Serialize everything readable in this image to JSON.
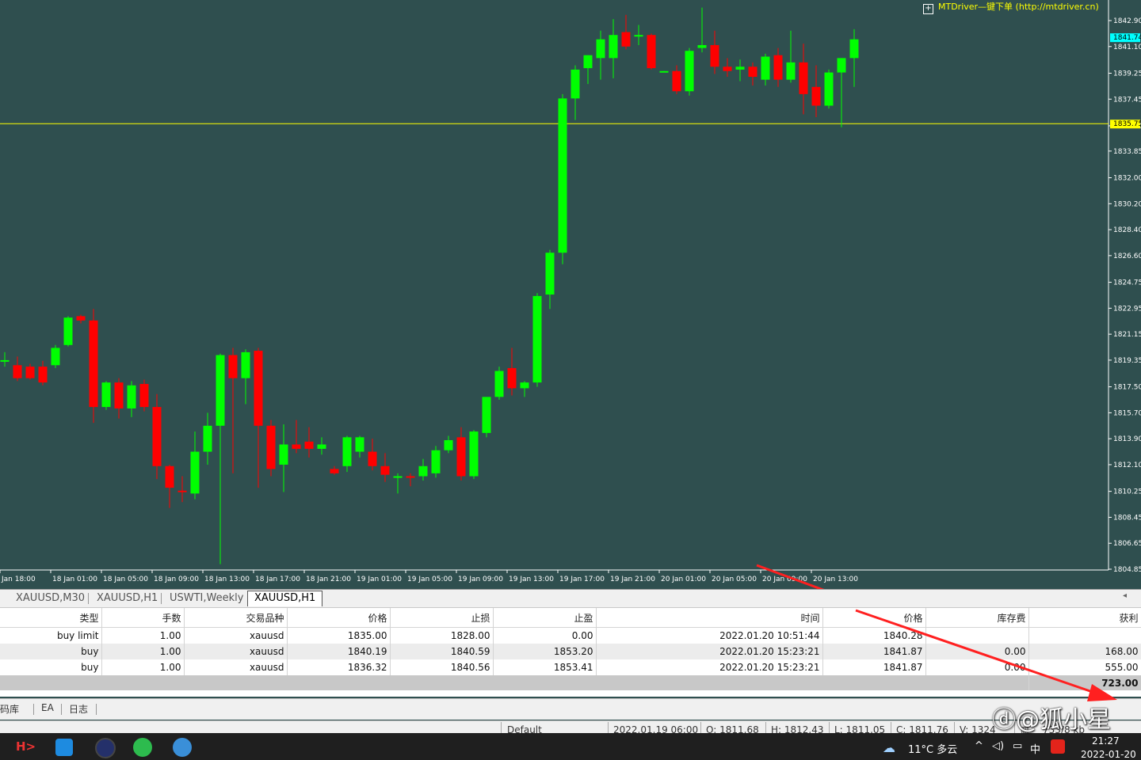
{
  "chart": {
    "plugin_label": "MTDriver—键下单 (http://mtdriver.cn)",
    "price_labels": [
      "1842.90",
      "1841.10",
      "1839.25",
      "1837.45",
      "1835.60",
      "1833.85",
      "1832.00",
      "1830.20",
      "1828.40",
      "1826.60",
      "1824.75",
      "1822.95",
      "1821.15",
      "1819.35",
      "1817.50",
      "1815.70",
      "1813.90",
      "1812.10",
      "1810.25",
      "1808.45",
      "1806.65",
      "1804.85"
    ],
    "current_price_label": "1841.74",
    "hline_price_label": "1835.75",
    "time_labels": [
      "Jan 18:00",
      "18 Jan 01:00",
      "18 Jan 05:00",
      "18 Jan 09:00",
      "18 Jan 13:00",
      "18 Jan 17:00",
      "18 Jan 21:00",
      "19 Jan 01:00",
      "19 Jan 05:00",
      "19 Jan 09:00",
      "19 Jan 13:00",
      "19 Jan 17:00",
      "19 Jan 21:00",
      "20 Jan 01:00",
      "20 Jan 05:00",
      "20 Jan 09:00",
      "20 Jan 13:00"
    ],
    "bull_color": "#00ff00",
    "bear_color": "#ff0000",
    "grid_color": "#ffff00"
  },
  "chart_data": {
    "type": "candlestick",
    "symbol": "XAUUSD",
    "timeframe": "H1",
    "ylim": [
      1804.85,
      1842.9
    ],
    "hline": 1835.75,
    "candles": [
      {
        "o": 1819.35,
        "h": 1819.9,
        "l": 1818.9,
        "c": 1819.35
      },
      {
        "o": 1819.0,
        "h": 1819.6,
        "l": 1817.9,
        "c": 1818.1
      },
      {
        "o": 1818.9,
        "h": 1819.1,
        "l": 1818.0,
        "c": 1818.1
      },
      {
        "o": 1818.9,
        "h": 1819.3,
        "l": 1817.6,
        "c": 1817.8
      },
      {
        "o": 1819.0,
        "h": 1820.4,
        "l": 1818.8,
        "c": 1820.2
      },
      {
        "o": 1820.4,
        "h": 1822.4,
        "l": 1820.3,
        "c": 1822.3
      },
      {
        "o": 1822.4,
        "h": 1822.5,
        "l": 1821.9,
        "c": 1822.1
      },
      {
        "o": 1822.1,
        "h": 1822.9,
        "l": 1815.0,
        "c": 1816.1
      },
      {
        "o": 1816.1,
        "h": 1817.9,
        "l": 1815.9,
        "c": 1817.8
      },
      {
        "o": 1817.8,
        "h": 1818.1,
        "l": 1815.3,
        "c": 1816.0
      },
      {
        "o": 1816.0,
        "h": 1817.9,
        "l": 1815.4,
        "c": 1817.6
      },
      {
        "o": 1817.7,
        "h": 1818.0,
        "l": 1815.8,
        "c": 1816.1
      },
      {
        "o": 1816.1,
        "h": 1817.0,
        "l": 1811.1,
        "c": 1812.0
      },
      {
        "o": 1812.0,
        "h": 1812.1,
        "l": 1809.1,
        "c": 1810.5
      },
      {
        "o": 1810.3,
        "h": 1811.3,
        "l": 1809.5,
        "c": 1810.2
      },
      {
        "o": 1810.1,
        "h": 1814.4,
        "l": 1809.7,
        "c": 1813.0
      },
      {
        "o": 1813.0,
        "h": 1815.7,
        "l": 1812.1,
        "c": 1814.8
      },
      {
        "o": 1814.8,
        "h": 1819.8,
        "l": 1805.2,
        "c": 1819.7
      },
      {
        "o": 1819.7,
        "h": 1820.2,
        "l": 1811.5,
        "c": 1818.1
      },
      {
        "o": 1818.1,
        "h": 1820.1,
        "l": 1816.3,
        "c": 1819.9
      },
      {
        "o": 1820.0,
        "h": 1820.2,
        "l": 1810.5,
        "c": 1814.8
      },
      {
        "o": 1814.8,
        "h": 1815.2,
        "l": 1811.3,
        "c": 1811.8
      },
      {
        "o": 1812.1,
        "h": 1814.9,
        "l": 1810.2,
        "c": 1813.5
      },
      {
        "o": 1813.5,
        "h": 1815.2,
        "l": 1812.9,
        "c": 1813.2
      },
      {
        "o": 1813.7,
        "h": 1814.7,
        "l": 1812.6,
        "c": 1813.2
      },
      {
        "o": 1813.2,
        "h": 1814.0,
        "l": 1812.8,
        "c": 1813.5
      },
      {
        "o": 1811.8,
        "h": 1812.0,
        "l": 1811.4,
        "c": 1811.5
      },
      {
        "o": 1812.0,
        "h": 1814.1,
        "l": 1811.6,
        "c": 1814.0
      },
      {
        "o": 1813.0,
        "h": 1814.1,
        "l": 1812.6,
        "c": 1814.0
      },
      {
        "o": 1813.0,
        "h": 1813.9,
        "l": 1811.7,
        "c": 1812.0
      },
      {
        "o": 1812.0,
        "h": 1812.9,
        "l": 1810.9,
        "c": 1811.4
      },
      {
        "o": 1811.3,
        "h": 1811.5,
        "l": 1810.1,
        "c": 1811.3
      },
      {
        "o": 1811.3,
        "h": 1811.5,
        "l": 1810.6,
        "c": 1811.2
      },
      {
        "o": 1811.3,
        "h": 1812.5,
        "l": 1811.0,
        "c": 1812.0
      },
      {
        "o": 1811.5,
        "h": 1813.4,
        "l": 1811.2,
        "c": 1813.1
      },
      {
        "o": 1813.1,
        "h": 1814.1,
        "l": 1812.9,
        "c": 1813.8
      },
      {
        "o": 1814.0,
        "h": 1814.7,
        "l": 1811.0,
        "c": 1811.3
      },
      {
        "o": 1811.3,
        "h": 1814.5,
        "l": 1811.1,
        "c": 1814.4
      },
      {
        "o": 1814.3,
        "h": 1815.5,
        "l": 1814.0,
        "c": 1816.8
      },
      {
        "o": 1816.8,
        "h": 1818.9,
        "l": 1816.6,
        "c": 1818.6
      },
      {
        "o": 1818.8,
        "h": 1820.2,
        "l": 1816.9,
        "c": 1817.4
      },
      {
        "o": 1817.4,
        "h": 1817.9,
        "l": 1816.8,
        "c": 1817.8
      },
      {
        "o": 1817.8,
        "h": 1824.0,
        "l": 1817.5,
        "c": 1823.8
      },
      {
        "o": 1823.9,
        "h": 1827.0,
        "l": 1822.9,
        "c": 1826.8
      },
      {
        "o": 1826.8,
        "h": 1837.8,
        "l": 1826.0,
        "c": 1837.5
      },
      {
        "o": 1837.5,
        "h": 1839.8,
        "l": 1836.0,
        "c": 1839.5
      },
      {
        "o": 1839.6,
        "h": 1840.5,
        "l": 1838.5,
        "c": 1840.5
      },
      {
        "o": 1840.3,
        "h": 1842.2,
        "l": 1838.8,
        "c": 1841.6
      },
      {
        "o": 1840.3,
        "h": 1843.0,
        "l": 1838.9,
        "c": 1841.9
      },
      {
        "o": 1842.1,
        "h": 1843.3,
        "l": 1840.9,
        "c": 1841.1
      },
      {
        "o": 1841.9,
        "h": 1842.6,
        "l": 1841.2,
        "c": 1841.9
      },
      {
        "o": 1841.9,
        "h": 1842.0,
        "l": 1839.5,
        "c": 1839.6
      },
      {
        "o": 1839.4,
        "h": 1839.4,
        "l": 1839.3,
        "c": 1839.4
      },
      {
        "o": 1839.4,
        "h": 1839.8,
        "l": 1837.8,
        "c": 1838.0
      },
      {
        "o": 1838.0,
        "h": 1841.0,
        "l": 1837.7,
        "c": 1840.8
      },
      {
        "o": 1841.0,
        "h": 1843.8,
        "l": 1840.7,
        "c": 1841.2
      },
      {
        "o": 1841.2,
        "h": 1842.2,
        "l": 1839.2,
        "c": 1839.7
      },
      {
        "o": 1839.7,
        "h": 1840.3,
        "l": 1839.0,
        "c": 1839.4
      },
      {
        "o": 1839.5,
        "h": 1840.2,
        "l": 1838.7,
        "c": 1839.7
      },
      {
        "o": 1839.7,
        "h": 1840.0,
        "l": 1838.4,
        "c": 1839.0
      },
      {
        "o": 1838.8,
        "h": 1840.6,
        "l": 1838.4,
        "c": 1840.4
      },
      {
        "o": 1840.5,
        "h": 1841.0,
        "l": 1838.3,
        "c": 1838.8
      },
      {
        "o": 1838.8,
        "h": 1842.2,
        "l": 1838.6,
        "c": 1840.0
      },
      {
        "o": 1840.0,
        "h": 1841.3,
        "l": 1836.4,
        "c": 1837.8
      },
      {
        "o": 1838.3,
        "h": 1839.8,
        "l": 1836.2,
        "c": 1837.0
      },
      {
        "o": 1837.0,
        "h": 1839.5,
        "l": 1836.8,
        "c": 1839.3
      },
      {
        "o": 1839.3,
        "h": 1840.3,
        "l": 1835.5,
        "c": 1840.3
      },
      {
        "o": 1840.3,
        "h": 1842.3,
        "l": 1838.3,
        "c": 1841.6
      }
    ]
  },
  "tabs": [
    "XAUUSD,M30",
    "XAUUSD,H1",
    "USWTI,Weekly",
    "XAUUSD,H1"
  ],
  "orders": {
    "headers": [
      "类型",
      "手数",
      "交易品种",
      "价格",
      "止损",
      "止盈",
      "时间",
      "价格",
      "库存费",
      "获利"
    ],
    "rows": [
      [
        "buy limit",
        "1.00",
        "xauusd",
        "1835.00",
        "1828.00",
        "0.00",
        "2022.01.20 10:51:44",
        "1840.28",
        "",
        ""
      ],
      [
        "buy",
        "1.00",
        "xauusd",
        "1840.19",
        "1840.59",
        "1853.20",
        "2022.01.20 15:23:21",
        "1841.87",
        "0.00",
        "168.00"
      ],
      [
        "buy",
        "1.00",
        "xauusd",
        "1836.32",
        "1840.56",
        "1853.41",
        "2022.01.20 15:23:21",
        "1841.87",
        "0.00",
        "555.00"
      ]
    ],
    "total": "723.00"
  },
  "bottom_tabs": [
    "代码库",
    "EA",
    "日志"
  ],
  "statusbar": {
    "profile": "Default",
    "datetime": "2022.01.19 06:00",
    "open": "O: 1811.68",
    "high": "H: 1812.43",
    "low": "L: 1811.05",
    "close": "C: 1811.76",
    "volume": "V: 1324",
    "traffic": "733/8 kb"
  },
  "taskbar": {
    "weather": "11°C 多云",
    "ime": "中",
    "time": "21:27",
    "date": "2022-01-20"
  },
  "watermark": "@狐小星"
}
